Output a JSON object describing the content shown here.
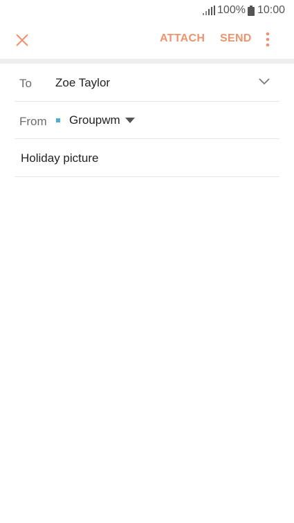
{
  "status_bar": {
    "battery_percent": "100%",
    "time": "10:00",
    "icons": [
      "signal-icon",
      "battery-icon"
    ]
  },
  "toolbar": {
    "close_icon": "close-icon",
    "attach_label": "ATTACH",
    "send_label": "SEND",
    "more_icon": "more-vertical-icon"
  },
  "compose": {
    "to": {
      "label": "To",
      "value": "Zoe Taylor",
      "expand_icon": "chevron-down-icon"
    },
    "from": {
      "label": "From",
      "account": "Groupwm",
      "dropdown_icon": "caret-down-icon"
    },
    "subject": {
      "value": "Holiday picture"
    },
    "body": {
      "value": ""
    }
  },
  "colors": {
    "accent": "#f0926a",
    "account_dot": "#4bb0d0",
    "divider": "#eeeeee"
  }
}
